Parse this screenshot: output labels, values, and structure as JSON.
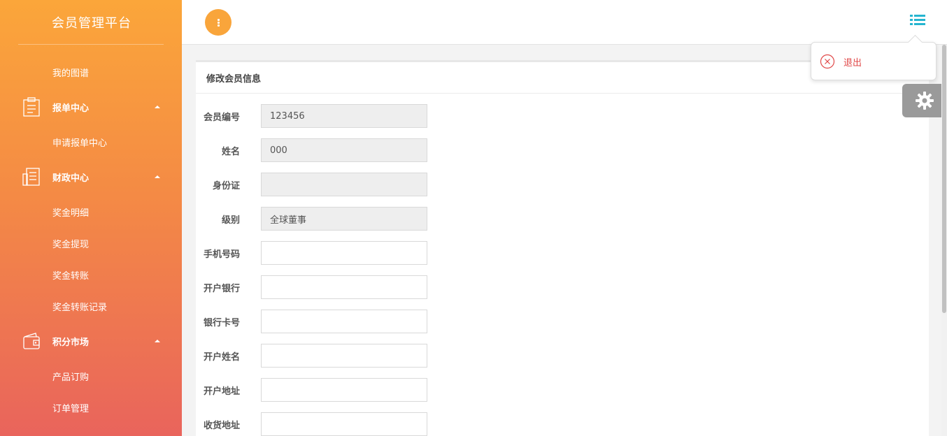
{
  "sidebar": {
    "brand": "会员管理平台",
    "items": [
      {
        "type": "sub",
        "label": "我的图谱"
      },
      {
        "type": "group",
        "label": "报单中心",
        "icon": "clipboard-icon"
      },
      {
        "type": "sub",
        "label": "申请报单中心"
      },
      {
        "type": "group",
        "label": "财政中心",
        "icon": "ledger-icon"
      },
      {
        "type": "sub",
        "label": "奖金明细"
      },
      {
        "type": "sub",
        "label": "奖金提现"
      },
      {
        "type": "sub",
        "label": "奖金转账"
      },
      {
        "type": "sub",
        "label": "奖金转账记录"
      },
      {
        "type": "group",
        "label": "积分市场",
        "icon": "wallet-icon"
      },
      {
        "type": "sub",
        "label": "产品订购"
      },
      {
        "type": "sub",
        "label": "订单管理"
      }
    ]
  },
  "topbar": {
    "menu_icon": "vertical-ellipsis-icon",
    "list_icon": "list-icon"
  },
  "dropdown": {
    "logout_label": "退出"
  },
  "form": {
    "title": "修改会员信息",
    "fields": [
      {
        "label": "会员编号",
        "value": "123456",
        "readonly": true
      },
      {
        "label": "姓名",
        "value": "000",
        "readonly": true
      },
      {
        "label": "身份证",
        "value": "",
        "readonly": true
      },
      {
        "label": "级别",
        "value": "全球董事",
        "readonly": true
      },
      {
        "label": "手机号码",
        "value": "",
        "readonly": false
      },
      {
        "label": "开户银行",
        "value": "",
        "readonly": false
      },
      {
        "label": "银行卡号",
        "value": "",
        "readonly": false
      },
      {
        "label": "开户姓名",
        "value": "",
        "readonly": false
      },
      {
        "label": "开户地址",
        "value": "",
        "readonly": false
      },
      {
        "label": "收货地址",
        "value": "",
        "readonly": false
      }
    ]
  },
  "colors": {
    "accent": "#f9a53b",
    "logout": "#e04848",
    "list_icon": "#26b5d0"
  }
}
